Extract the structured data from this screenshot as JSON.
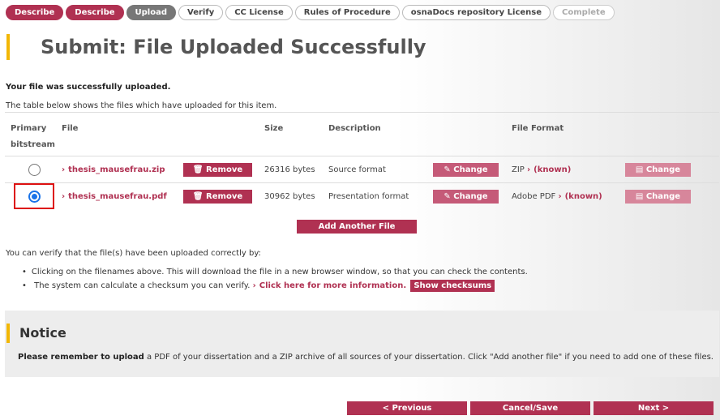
{
  "steps": [
    {
      "label": "Describe",
      "state": "active"
    },
    {
      "label": "Describe",
      "state": "active"
    },
    {
      "label": "Upload",
      "state": "current"
    },
    {
      "label": "Verify",
      "state": "normal"
    },
    {
      "label": "CC License",
      "state": "normal"
    },
    {
      "label": "Rules of Procedure",
      "state": "normal"
    },
    {
      "label": "osnaDocs repository License",
      "state": "normal"
    },
    {
      "label": "Complete",
      "state": "disabled"
    }
  ],
  "page_title": "Submit: File Uploaded Successfully",
  "success_message": "Your file was successfully uploaded.",
  "table_intro": "The table below shows the files which have uploaded for this item.",
  "table": {
    "headers": {
      "primary_line1": "Primary",
      "primary_line2": "bitstream",
      "file": "File",
      "size": "Size",
      "description": "Description",
      "file_format": "File Format"
    },
    "rows": [
      {
        "primary": false,
        "filename": "thesis_mausefrau.zip",
        "remove_label": "Remove",
        "size": "26316 bytes",
        "description": "Source format",
        "change_label": "Change",
        "format": "ZIP",
        "known": "(known)",
        "format_change_label": "Change"
      },
      {
        "primary": true,
        "filename": "thesis_mausefrau.pdf",
        "remove_label": "Remove",
        "size": "30962 bytes",
        "description": "Presentation format",
        "change_label": "Change",
        "format": "Adobe PDF",
        "known": "(known)",
        "format_change_label": "Change"
      }
    ]
  },
  "add_file_label": "Add Another File",
  "verify": {
    "intro": "You can verify that the file(s) have been uploaded correctly by:",
    "item1": "Clicking on the filenames above. This will download the file in a new browser window, so that you can check the contents.",
    "item2_prefix": "The system can calculate a checksum you can verify.",
    "item2_link": "Click here for more information.",
    "checksums_label": "Show checksums"
  },
  "notice": {
    "title": "Notice",
    "bold": "Please remember to upload",
    "text": " a PDF of your dissertation and a ZIP archive of all sources of your dissertation. Click \"Add another file\" if you need to add one of these files."
  },
  "nav": {
    "previous": "< Previous",
    "cancel": "Cancel/Save",
    "next": "Next >"
  },
  "colors": {
    "accent": "#b03152",
    "highlight_bar": "#f2b705",
    "radio_selected": "#1a73e8"
  }
}
